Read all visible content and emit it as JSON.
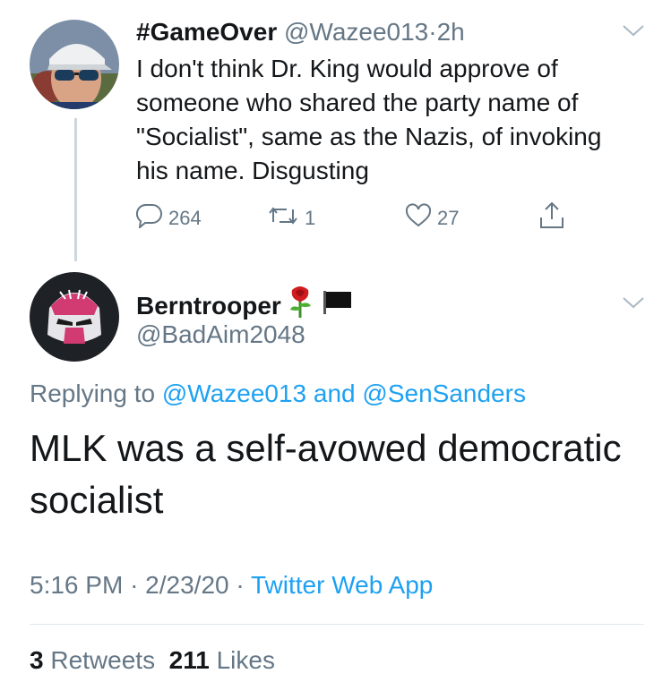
{
  "tweet1": {
    "display_name": "#GameOver",
    "handle": "@Wazee013",
    "separator": "·",
    "time": "2h",
    "text": "I don't think Dr. King would approve of someone who shared the party name of \"Socialist\", same as the Nazis, of invoking his name.  Disgusting",
    "reply_count": "264",
    "retweet_count": "1",
    "like_count": "27"
  },
  "tweet2": {
    "display_name": "Berntrooper",
    "handle": "@BadAim2048",
    "replying_prefix": "Replying to",
    "replying_user1": "@Wazee013",
    "replying_and": "and",
    "replying_user2": "@SenSanders",
    "text": "MLK was a self-avowed democratic socialist",
    "time": "5:16 PM",
    "dot": "·",
    "date": "2/23/20",
    "source": "Twitter Web App",
    "retweets_count": "3",
    "retweets_label": "Retweets",
    "likes_count": "211",
    "likes_label": "Likes"
  },
  "icons": [
    "reply-icon",
    "retweet-icon",
    "like-icon",
    "share-icon",
    "chevron-down-icon",
    "rose-emoji",
    "black-flag-emoji"
  ],
  "colors": {
    "link": "#1da1f2",
    "muted": "#657786",
    "text": "#14171a",
    "thread_line": "#ccd6dd"
  }
}
